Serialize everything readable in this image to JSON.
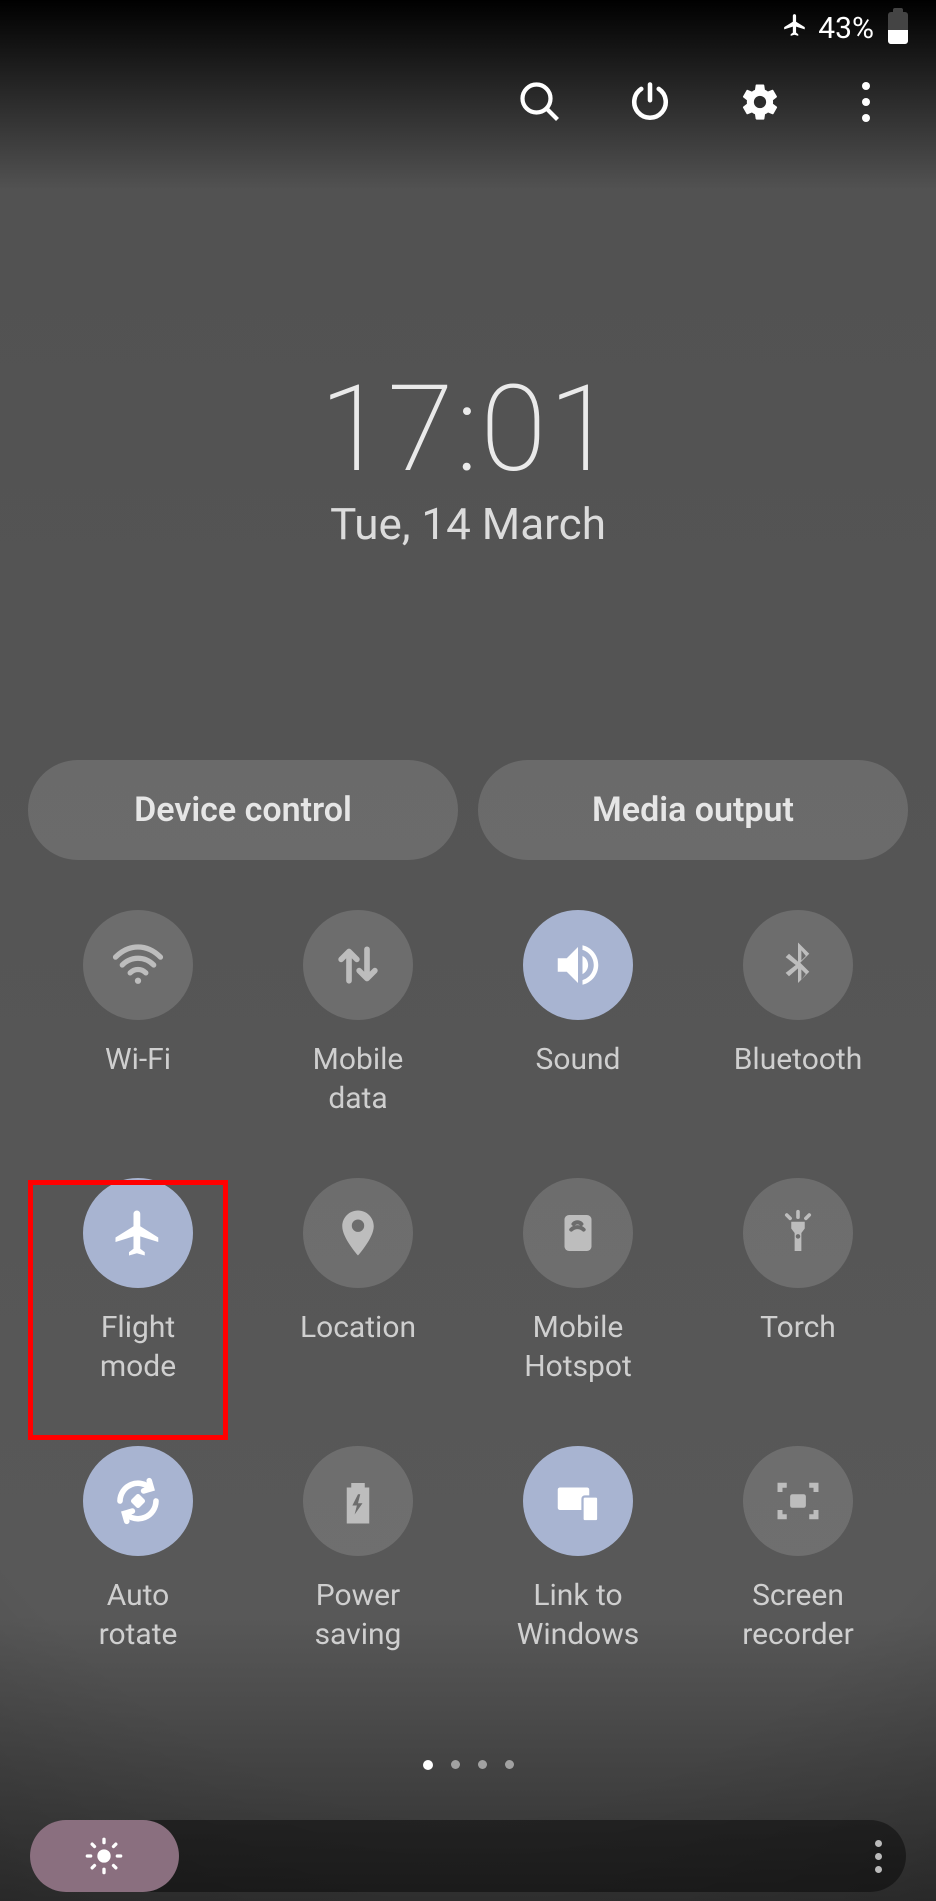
{
  "status": {
    "battery_pct": "43%"
  },
  "clock": {
    "time": "17:01",
    "date": "Tue, 14 March"
  },
  "pills": {
    "device_control": "Device control",
    "media_output": "Media output"
  },
  "tiles": {
    "wifi": "Wi-Fi",
    "mobile_data": "Mobile\ndata",
    "sound": "Sound",
    "bluetooth": "Bluetooth",
    "flight_mode": "Flight\nmode",
    "location": "Location",
    "mobile_hotspot": "Mobile\nHotspot",
    "torch": "Torch",
    "auto_rotate": "Auto\nrotate",
    "power_saving": "Power\nsaving",
    "link_windows": "Link to Windows",
    "screen_recorder": "Screen recorder"
  },
  "highlight": {
    "target": "flight_mode"
  }
}
